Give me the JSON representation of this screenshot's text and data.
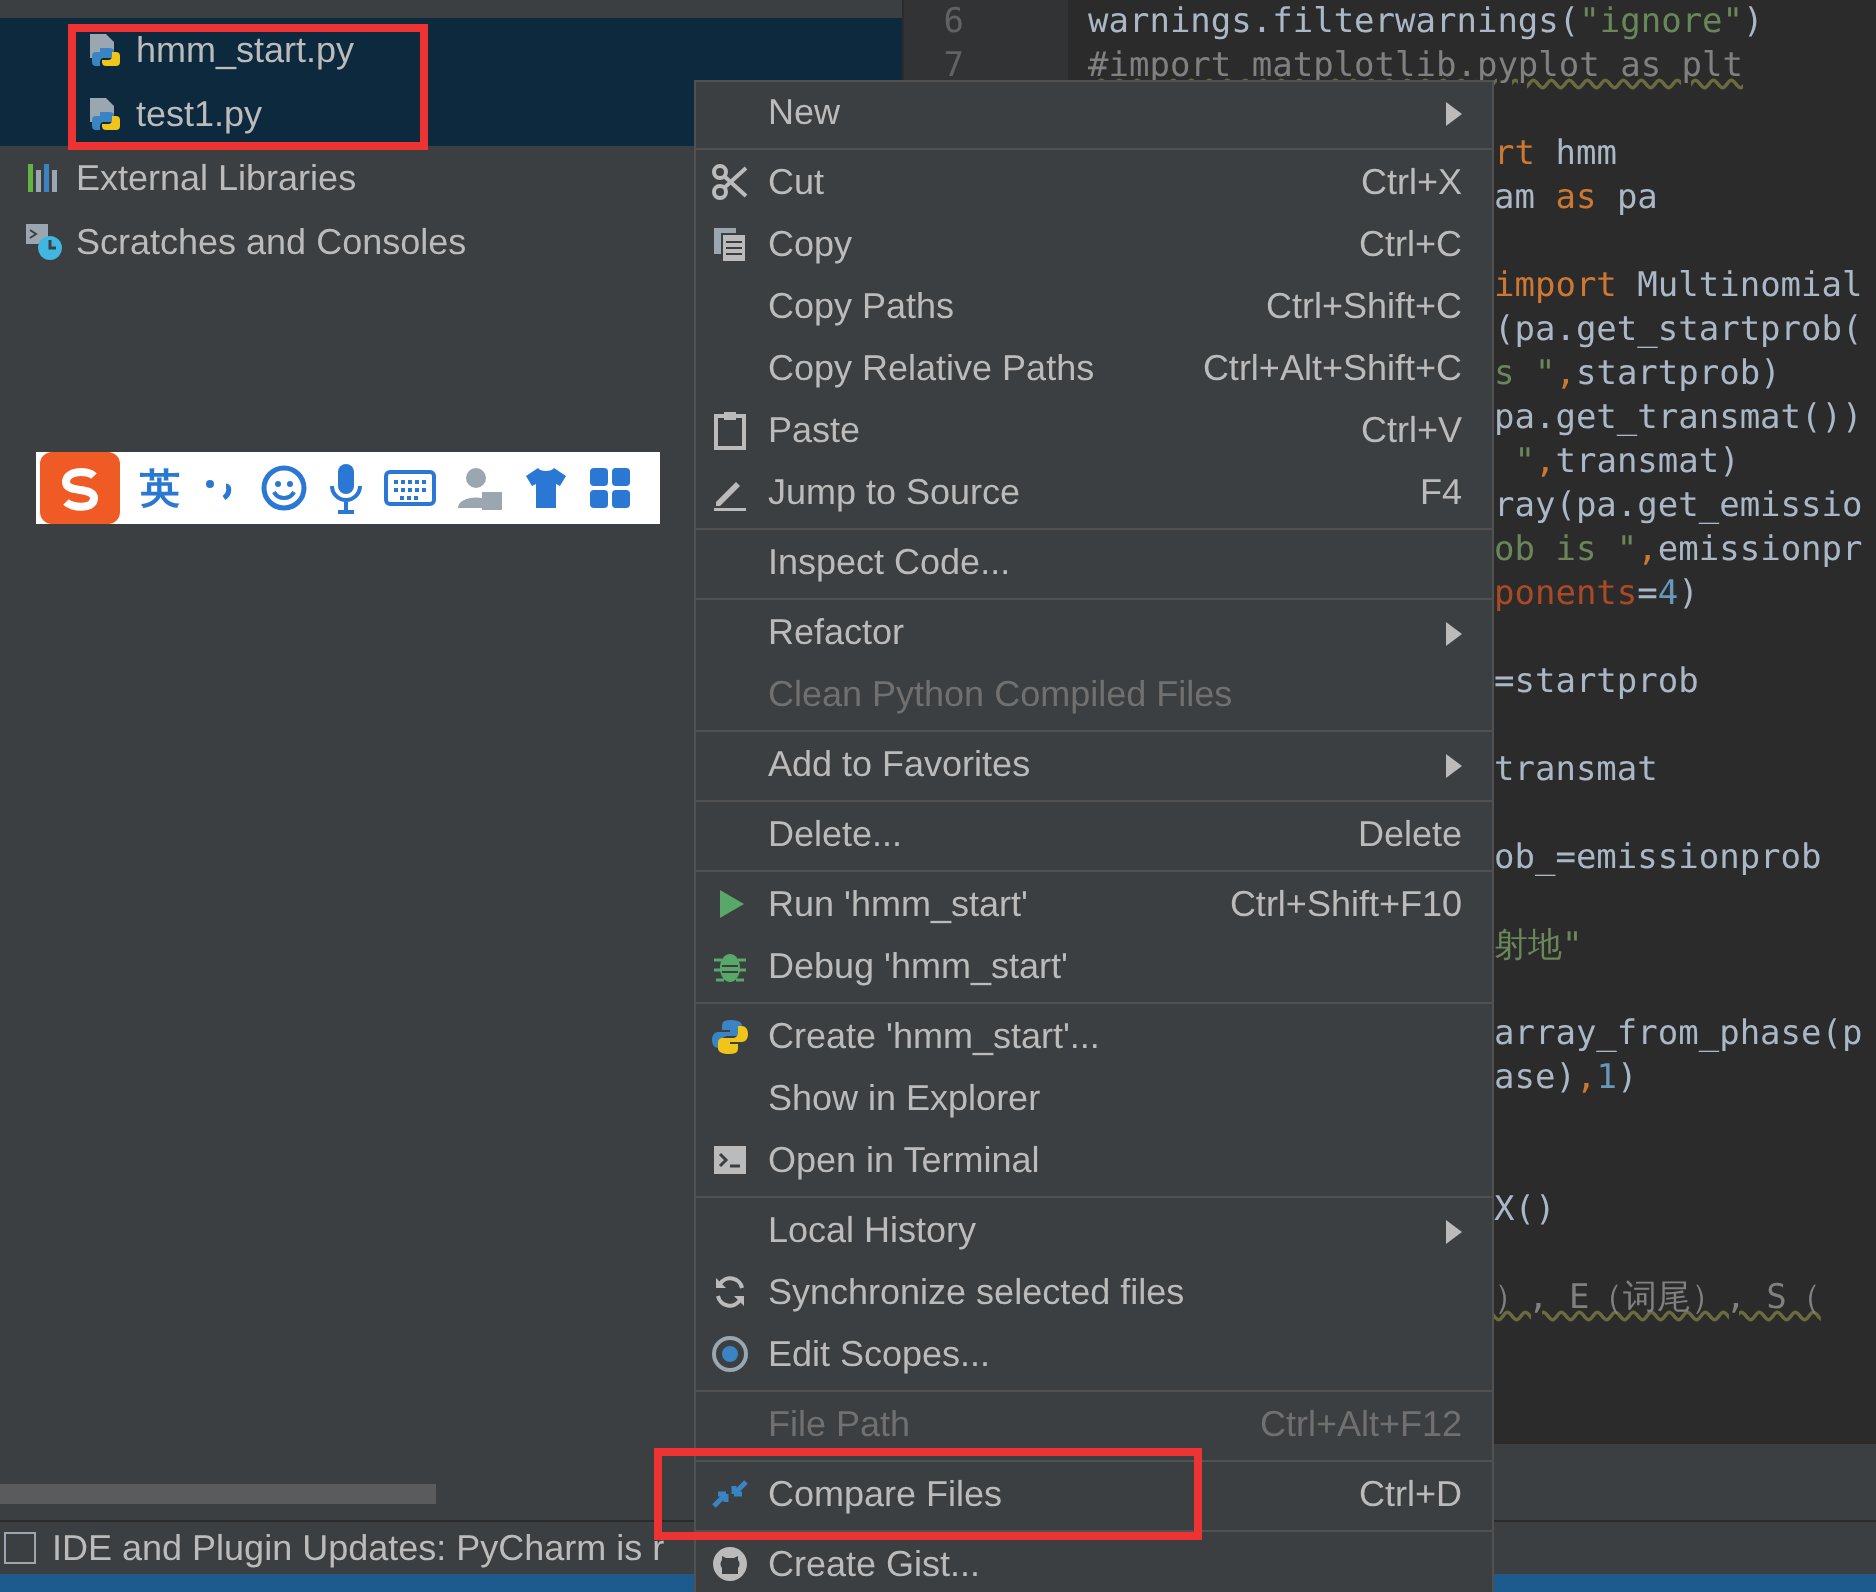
{
  "project_tree": {
    "items": [
      {
        "label": "hmm_start.py",
        "kind": "file",
        "selected": true
      },
      {
        "label": "test1.py",
        "kind": "file",
        "selected": true
      },
      {
        "label": "External Libraries",
        "kind": "library",
        "selected": false
      },
      {
        "label": "Scratches and Consoles",
        "kind": "scratches",
        "selected": false
      }
    ]
  },
  "ime_toolbar": {
    "mode": "英"
  },
  "editor": {
    "lines": [
      {
        "kind": "code",
        "number": "6",
        "tokens": [
          {
            "text": "warnings.filterwarnings(",
            "kind": "plain"
          },
          {
            "text": "\"ignore\"",
            "kind": "string"
          },
          {
            "text": ")",
            "kind": "plain"
          }
        ]
      },
      {
        "kind": "code",
        "number": "7",
        "tokens": [
          {
            "text": "#import matplotlib.pyplot as plt",
            "kind": "comment"
          }
        ]
      },
      {
        "kind": "blank"
      },
      {
        "kind": "code",
        "tokens": [
          {
            "text": "rt",
            "kind": "keyword"
          },
          {
            "text": " hmm",
            "kind": "plain"
          }
        ]
      },
      {
        "kind": "code",
        "tokens": [
          {
            "text": "am ",
            "kind": "plain"
          },
          {
            "text": "as",
            "kind": "keyword"
          },
          {
            "text": " pa",
            "kind": "plain"
          }
        ]
      },
      {
        "kind": "blank"
      },
      {
        "kind": "code",
        "tokens": [
          {
            "text": "import",
            "kind": "keyword"
          },
          {
            "text": " Multinomial",
            "kind": "plain"
          }
        ]
      },
      {
        "kind": "code",
        "tokens": [
          {
            "text": "(pa.get_startprob(",
            "kind": "plain"
          }
        ]
      },
      {
        "kind": "code",
        "tokens": [
          {
            "text": "s \"",
            "kind": "string"
          },
          {
            "text": ",",
            "kind": "keyword"
          },
          {
            "text": "startprob)",
            "kind": "plain"
          }
        ]
      },
      {
        "kind": "code",
        "tokens": [
          {
            "text": "pa.get_transmat())",
            "kind": "plain"
          }
        ]
      },
      {
        "kind": "code",
        "tokens": [
          {
            "text": " \"",
            "kind": "string"
          },
          {
            "text": ",",
            "kind": "keyword"
          },
          {
            "text": "transmat)",
            "kind": "plain"
          }
        ]
      },
      {
        "kind": "code",
        "tokens": [
          {
            "text": "ray(pa.get_emissio",
            "kind": "plain"
          }
        ]
      },
      {
        "kind": "code",
        "tokens": [
          {
            "text": "ob is \"",
            "kind": "string"
          },
          {
            "text": ",",
            "kind": "keyword"
          },
          {
            "text": "emissionpr",
            "kind": "plain"
          }
        ]
      },
      {
        "kind": "code",
        "tokens": [
          {
            "text": "ponents",
            "kind": "param"
          },
          {
            "text": "=",
            "kind": "plain"
          },
          {
            "text": "4",
            "kind": "number"
          },
          {
            "text": ")",
            "kind": "plain"
          }
        ]
      },
      {
        "kind": "blank"
      },
      {
        "kind": "code",
        "tokens": [
          {
            "text": "=startprob",
            "kind": "plain"
          }
        ]
      },
      {
        "kind": "blank"
      },
      {
        "kind": "code",
        "tokens": [
          {
            "text": "transmat",
            "kind": "plain"
          }
        ]
      },
      {
        "kind": "blank"
      },
      {
        "kind": "code",
        "tokens": [
          {
            "text": "ob_=emissionprob",
            "kind": "plain"
          }
        ]
      },
      {
        "kind": "blank"
      },
      {
        "kind": "code",
        "tokens": [
          {
            "text": "射地\"",
            "kind": "string"
          }
        ]
      },
      {
        "kind": "blank"
      },
      {
        "kind": "code",
        "tokens": [
          {
            "text": "array_from_phase(p",
            "kind": "plain"
          }
        ]
      },
      {
        "kind": "code",
        "tokens": [
          {
            "text": "ase)",
            "kind": "plain"
          },
          {
            "text": ",",
            "kind": "keyword"
          },
          {
            "text": "1",
            "kind": "number"
          },
          {
            "text": ")",
            "kind": "plain"
          }
        ]
      },
      {
        "kind": "blank"
      },
      {
        "kind": "blank"
      },
      {
        "kind": "code",
        "tokens": [
          {
            "text": "X()",
            "kind": "plain"
          }
        ]
      },
      {
        "kind": "blank"
      },
      {
        "kind": "code",
        "tokens": [
          {
            "text": "）, E（词尾）, S（",
            "kind": "comment"
          }
        ]
      }
    ]
  },
  "context_menu": {
    "items": [
      {
        "kind": "item",
        "label": "New",
        "submenu": true,
        "disabled": false
      },
      {
        "kind": "separator"
      },
      {
        "kind": "item",
        "label": "Cut",
        "shortcut": "Ctrl+X",
        "submenu": false,
        "disabled": false
      },
      {
        "kind": "item",
        "label": "Copy",
        "shortcut": "Ctrl+C",
        "submenu": false,
        "disabled": false
      },
      {
        "kind": "item",
        "label": "Copy Paths",
        "shortcut": "Ctrl+Shift+C",
        "submenu": false,
        "disabled": false
      },
      {
        "kind": "item",
        "label": "Copy Relative Paths",
        "shortcut": "Ctrl+Alt+Shift+C",
        "submenu": false,
        "disabled": false
      },
      {
        "kind": "item",
        "label": "Paste",
        "shortcut": "Ctrl+V",
        "submenu": false,
        "disabled": false
      },
      {
        "kind": "item",
        "label": "Jump to Source",
        "shortcut": "F4",
        "submenu": false,
        "disabled": false
      },
      {
        "kind": "separator"
      },
      {
        "kind": "item",
        "label": "Inspect Code...",
        "submenu": false,
        "disabled": false
      },
      {
        "kind": "separator"
      },
      {
        "kind": "item",
        "label": "Refactor",
        "submenu": true,
        "disabled": false
      },
      {
        "kind": "item",
        "label": "Clean Python Compiled Files",
        "submenu": false,
        "disabled": true
      },
      {
        "kind": "separator"
      },
      {
        "kind": "item",
        "label": "Add to Favorites",
        "submenu": true,
        "disabled": false
      },
      {
        "kind": "separator"
      },
      {
        "kind": "item",
        "label": "Delete...",
        "shortcut": "Delete",
        "submenu": false,
        "disabled": false
      },
      {
        "kind": "separator"
      },
      {
        "kind": "item",
        "label": "Run 'hmm_start'",
        "shortcut": "Ctrl+Shift+F10",
        "submenu": false,
        "disabled": false
      },
      {
        "kind": "item",
        "label": "Debug 'hmm_start'",
        "submenu": false,
        "disabled": false
      },
      {
        "kind": "separator"
      },
      {
        "kind": "item",
        "label": "Create 'hmm_start'...",
        "submenu": false,
        "disabled": false
      },
      {
        "kind": "item",
        "label": "Show in Explorer",
        "submenu": false,
        "disabled": false
      },
      {
        "kind": "item",
        "label": "Open in Terminal",
        "submenu": false,
        "disabled": false
      },
      {
        "kind": "separator"
      },
      {
        "kind": "item",
        "label": "Local History",
        "submenu": true,
        "disabled": false
      },
      {
        "kind": "item",
        "label": "Synchronize selected files",
        "submenu": false,
        "disabled": false
      },
      {
        "kind": "item",
        "label": "Edit Scopes...",
        "submenu": false,
        "disabled": false
      },
      {
        "kind": "separator"
      },
      {
        "kind": "item",
        "label": "File Path",
        "shortcut": "Ctrl+Alt+F12",
        "submenu": false,
        "disabled": true
      },
      {
        "kind": "separator"
      },
      {
        "kind": "item",
        "label": "Compare Files",
        "shortcut": "Ctrl+D",
        "submenu": false,
        "disabled": false
      },
      {
        "kind": "separator"
      },
      {
        "kind": "item",
        "label": "Create Gist...",
        "submenu": false,
        "disabled": false
      }
    ]
  },
  "status_bar": {
    "message": "IDE and Plugin Updates: PyCharm is r"
  }
}
